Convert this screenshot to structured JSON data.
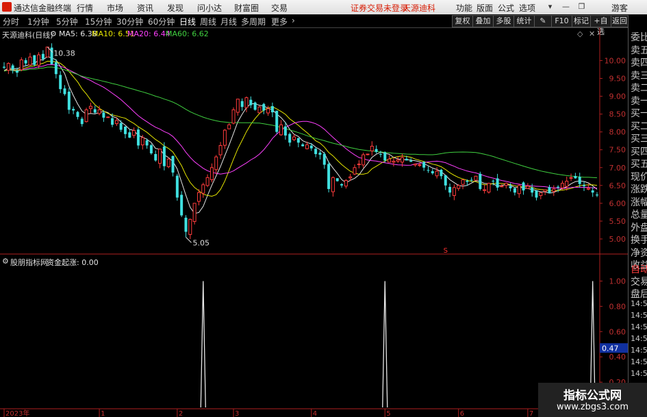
{
  "titlebar": {
    "app_name": "通达信金融终端",
    "menus": [
      "行情",
      "市场",
      "资讯",
      "发现",
      "问小达",
      "财富圈",
      "交易"
    ],
    "alert": "证券交易未登录",
    "stock_name": "天源迪科",
    "right_menus": [
      "功能",
      "版面",
      "公式",
      "选项"
    ],
    "user": "游客"
  },
  "toolbar": {
    "periods": [
      "分时",
      "1分钟",
      "5分钟",
      "15分钟",
      "30分钟",
      "60分钟",
      "日线",
      "周线",
      "月线",
      "多周期",
      "更多"
    ],
    "active_period": "日线",
    "buttons": [
      "复权",
      "叠加",
      "多股",
      "统计",
      "画线",
      "F10",
      "标记",
      "+自选",
      "返回"
    ]
  },
  "main_panel": {
    "title": "天源迪科(日线)",
    "ma": [
      {
        "label": "MA5: 6.38",
        "color": "#e6e6e6"
      },
      {
        "label": "MA10: 6.51",
        "color": "#e6e600"
      },
      {
        "label": "MA20: 6.44",
        "color": "#ff40ff"
      },
      {
        "label": "MA60: 6.62",
        "color": "#40d040"
      }
    ],
    "high_label": "10.38",
    "low_label": "5.05",
    "marker": "S",
    "y_ticks": [
      "10.00",
      "9.50",
      "9.00",
      "8.50",
      "8.00",
      "7.50",
      "7.00",
      "6.50",
      "6.00",
      "5.50",
      "5.00"
    ]
  },
  "sub_panel": {
    "title": "股朋指标网",
    "indicator": "资金起涨: 0.00",
    "y_ticks": [
      "1.00",
      "0.80",
      "0.60",
      "0.40",
      "0.20"
    ],
    "current_value": "0.47"
  },
  "x_axis": {
    "labels": [
      "2023年",
      "1",
      "2",
      "3",
      "4",
      "5",
      "6",
      "7"
    ]
  },
  "right_panel": {
    "items": [
      "委比",
      "卖五",
      "卖四",
      "卖三",
      "卖二",
      "卖一",
      "买一",
      "买二",
      "买三",
      "买四",
      "买五",
      "现价",
      "涨跌",
      "涨幅",
      "总量",
      "外盘",
      "换手",
      "净资",
      "收益",
      "自动",
      "交易",
      "盘后",
      "14:56",
      "14:56",
      "14:56",
      "14:56",
      "14:56",
      "14:56",
      "14:56"
    ]
  },
  "watermark": {
    "line1": "指标公式网",
    "line2": "www.zbgs3.com"
  },
  "chart_data": {
    "type": "candlestick",
    "title": "天源迪科(日线)",
    "y_range": [
      4.75,
      10.7
    ],
    "x_month_labels": [
      {
        "label": "2023年",
        "index": 0
      },
      {
        "label": "1",
        "index": 22
      },
      {
        "label": "2",
        "index": 40
      },
      {
        "label": "3",
        "index": 53
      },
      {
        "label": "4",
        "index": 71
      },
      {
        "label": "5",
        "index": 88
      },
      {
        "label": "6",
        "index": 105
      },
      {
        "label": "7",
        "index": 121
      }
    ],
    "closes": [
      9.8,
      9.92,
      9.75,
      9.66,
      10.02,
      9.92,
      10.1,
      9.88,
      10.16,
      10.04,
      10.38,
      9.9,
      9.62,
      9.2,
      9.06,
      8.62,
      8.6,
      8.42,
      8.22,
      8.62,
      8.72,
      8.54,
      8.62,
      8.4,
      8.42,
      8.2,
      8.32,
      8.06,
      7.94,
      7.84,
      8.04,
      7.62,
      7.84,
      7.62,
      7.4,
      7.2,
      7.52,
      7.04,
      7.24,
      6.86,
      6.16,
      5.66,
      5.2,
      5.55,
      6.0,
      6.3,
      6.52,
      6.72,
      7.0,
      7.3,
      7.62,
      8.05,
      8.2,
      8.62,
      8.92,
      8.7,
      8.96,
      8.75,
      8.62,
      8.7,
      8.6,
      8.65,
      8.55,
      8.0,
      8.2,
      7.9,
      7.7,
      7.86,
      7.7,
      7.6,
      7.64,
      7.54,
      7.38,
      7.36,
      7.08,
      6.4,
      6.72,
      6.62,
      6.5,
      6.64,
      6.74,
      7.0,
      7.1,
      7.36,
      7.38,
      7.6,
      7.44,
      7.38,
      7.2,
      7.24,
      7.18,
      7.22,
      7.28,
      7.2,
      7.16,
      7.1,
      7.08,
      7.0,
      6.92,
      6.84,
      6.9,
      6.76,
      6.5,
      6.3,
      6.44,
      6.5,
      6.66,
      6.6,
      6.64,
      6.76,
      6.4,
      6.38,
      6.56,
      6.62,
      6.44,
      6.48,
      6.56,
      6.42,
      6.3,
      6.5,
      6.36,
      6.48,
      6.3,
      6.16,
      6.3,
      6.38,
      6.28,
      6.4,
      6.44,
      6.56,
      6.62,
      6.72,
      6.7,
      6.54,
      6.48,
      6.42,
      6.3,
      6.22
    ],
    "ma5": 6.38,
    "ma10": 6.51,
    "ma20": 6.44,
    "ma60": 6.62,
    "high": 10.38,
    "low": 5.05,
    "indicator": {
      "name": "资金起涨",
      "value": 0.0,
      "spike_indices": [
        46,
        88,
        136
      ],
      "y_range": [
        0,
        1.1
      ]
    }
  }
}
